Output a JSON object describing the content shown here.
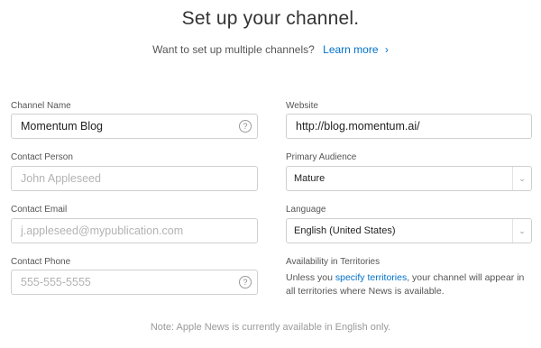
{
  "header": {
    "title": "Set up your channel.",
    "subtitle": "Want to set up multiple channels?",
    "learn_more": "Learn more",
    "learn_more_chevron": "›"
  },
  "form": {
    "channel_name": {
      "label": "Channel Name",
      "value": "Momentum Blog",
      "help_icon": "?"
    },
    "contact_person": {
      "label": "Contact Person",
      "placeholder": "John Appleseed"
    },
    "contact_email": {
      "label": "Contact Email",
      "placeholder": "j.appleseed@mypublication.com"
    },
    "contact_phone": {
      "label": "Contact Phone",
      "placeholder": "555-555-5555",
      "help_icon": "?"
    },
    "website": {
      "label": "Website",
      "value": "http://blog.momentum.ai/"
    },
    "primary_audience": {
      "label": "Primary Audience",
      "value": "Mature",
      "arrow": "⌄"
    },
    "language": {
      "label": "Language",
      "value": "English (United States)",
      "arrow": "⌄"
    },
    "availability": {
      "label": "Availability in Territories",
      "text_before": "Unless you ",
      "link": "specify territories",
      "text_after": ", your channel will appear in all territories where News is available."
    }
  },
  "note": "Note: Apple News is currently available in English only.",
  "colors": {
    "link": "#0070c9",
    "border": "#cfcfcf",
    "placeholder": "#b3b3b3"
  }
}
